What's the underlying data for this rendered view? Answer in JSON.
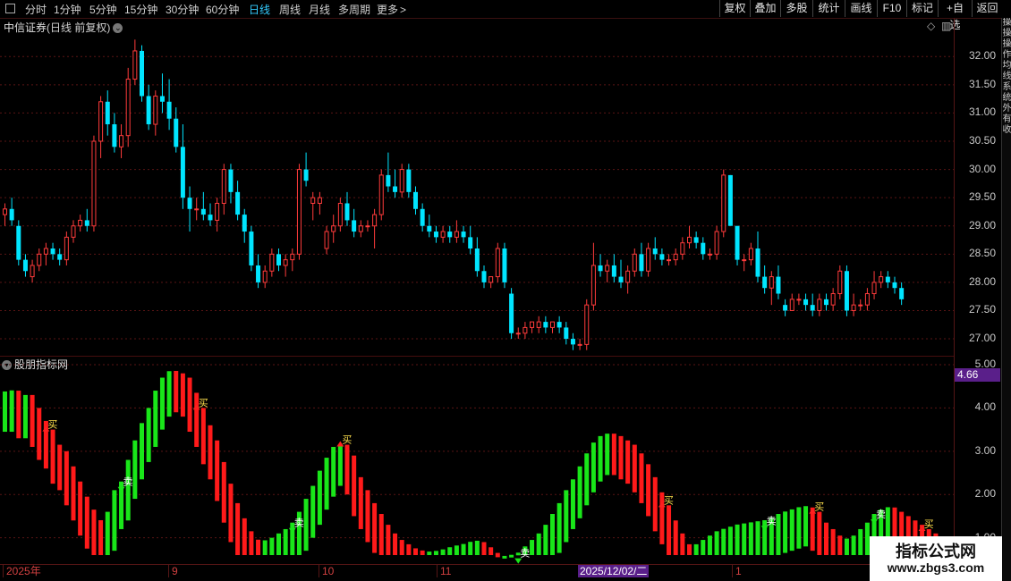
{
  "toolbar": {
    "timeframes": [
      {
        "label": "分时",
        "active": false
      },
      {
        "label": "1分钟",
        "active": false
      },
      {
        "label": "5分钟",
        "active": false
      },
      {
        "label": "15分钟",
        "active": false
      },
      {
        "label": "30分钟",
        "active": false
      },
      {
        "label": "60分钟",
        "active": false
      },
      {
        "label": "日线",
        "active": true
      },
      {
        "label": "周线",
        "active": false
      },
      {
        "label": "月线",
        "active": false
      },
      {
        "label": "多周期",
        "active": false
      },
      {
        "label": "更多",
        "active": false
      }
    ],
    "more_arrow": ">",
    "right_buttons": [
      "复权",
      "叠加",
      "多股",
      "统计",
      "画线",
      "F10",
      "标记",
      "+自选",
      "返回"
    ]
  },
  "chart": {
    "title": "中信证券",
    "subtitle": "(日线 前复权)",
    "y_ticks": [
      "32.00",
      "31.50",
      "31.00",
      "30.50",
      "30.00",
      "29.50",
      "29.00",
      "28.50",
      "28.00",
      "27.50",
      "27.00"
    ]
  },
  "indicator": {
    "title": "股朋指标网",
    "current_value": "4.66",
    "y_ticks": [
      "5.00",
      "4.00",
      "3.00",
      "2.00",
      "1.00"
    ],
    "buy_label": "买",
    "sell_label": "卖",
    "buy_signals": [
      6,
      28,
      49,
      96,
      118,
      134
    ],
    "sell_signals": [
      17,
      42,
      75,
      111,
      127
    ]
  },
  "date_axis": {
    "labels": [
      "2025年",
      "9",
      "10",
      "11",
      "1"
    ],
    "cursor": "2025/12/02/二"
  },
  "side_strip": [
    "操",
    "操",
    "操",
    "作",
    "均",
    "线",
    "系",
    "统",
    "外",
    "有",
    "收"
  ],
  "watermark": {
    "title": "指标公式网",
    "url": "www.zbgs3.com"
  },
  "colors": {
    "up": "#ff3b3b",
    "down": "#00e5ff",
    "ind_red": "#ff1a1a",
    "ind_green": "#19e619",
    "accent_purple": "#5a1f8a"
  },
  "chart_data": {
    "type": "candlestick",
    "price_range": [
      26.7,
      32.4
    ],
    "indicator_range": [
      0.6,
      5.0
    ],
    "candles": [
      [
        29.2,
        29.4,
        29.0,
        29.3
      ],
      [
        29.3,
        29.5,
        29.0,
        29.1
      ],
      [
        29.0,
        29.1,
        28.3,
        28.4
      ],
      [
        28.4,
        28.5,
        28.1,
        28.2
      ],
      [
        28.1,
        28.4,
        28.0,
        28.3
      ],
      [
        28.3,
        28.6,
        28.2,
        28.5
      ],
      [
        28.5,
        28.7,
        28.3,
        28.6
      ],
      [
        28.6,
        28.7,
        28.4,
        28.5
      ],
      [
        28.5,
        28.6,
        28.3,
        28.4
      ],
      [
        28.4,
        28.9,
        28.3,
        28.8
      ],
      [
        28.8,
        29.1,
        28.7,
        29.0
      ],
      [
        29.0,
        29.2,
        28.9,
        29.1
      ],
      [
        29.1,
        29.3,
        28.9,
        29.0
      ],
      [
        29.0,
        30.6,
        28.9,
        30.5
      ],
      [
        30.5,
        31.3,
        30.2,
        31.2
      ],
      [
        31.2,
        31.4,
        30.6,
        30.8
      ],
      [
        30.8,
        31.0,
        30.3,
        30.4
      ],
      [
        30.4,
        30.8,
        30.2,
        30.6
      ],
      [
        30.6,
        31.8,
        30.4,
        31.6
      ],
      [
        31.6,
        32.3,
        31.5,
        32.1
      ],
      [
        32.1,
        32.2,
        31.2,
        31.3
      ],
      [
        31.3,
        31.5,
        30.7,
        30.8
      ],
      [
        30.8,
        31.4,
        30.6,
        31.3
      ],
      [
        31.3,
        31.7,
        31.0,
        31.2
      ],
      [
        31.2,
        31.6,
        30.7,
        30.9
      ],
      [
        30.9,
        31.1,
        30.3,
        30.4
      ],
      [
        30.4,
        30.8,
        29.3,
        29.5
      ],
      [
        29.5,
        29.7,
        28.9,
        29.3
      ],
      [
        29.3,
        29.5,
        29.1,
        29.3
      ],
      [
        29.3,
        29.6,
        29.1,
        29.2
      ],
      [
        29.2,
        29.4,
        29.0,
        29.1
      ],
      [
        29.1,
        29.5,
        28.9,
        29.4
      ],
      [
        29.4,
        30.1,
        29.2,
        30.0
      ],
      [
        30.0,
        30.1,
        29.4,
        29.6
      ],
      [
        29.6,
        29.8,
        29.1,
        29.2
      ],
      [
        29.2,
        29.3,
        28.7,
        28.9
      ],
      [
        28.9,
        29.0,
        28.2,
        28.3
      ],
      [
        28.3,
        28.5,
        27.9,
        28.0
      ],
      [
        28.0,
        28.3,
        27.9,
        28.2
      ],
      [
        28.2,
        28.6,
        28.1,
        28.5
      ],
      [
        28.5,
        28.6,
        28.2,
        28.3
      ],
      [
        28.3,
        28.5,
        28.1,
        28.4
      ],
      [
        28.4,
        28.6,
        28.2,
        28.5
      ],
      [
        28.5,
        30.1,
        28.4,
        30.0
      ],
      [
        30.0,
        30.3,
        29.7,
        29.8
      ],
      [
        29.4,
        29.6,
        29.1,
        29.5
      ],
      [
        29.4,
        29.6,
        29.2,
        29.5
      ],
      [
        28.6,
        29.0,
        28.5,
        28.9
      ],
      [
        28.9,
        29.2,
        28.7,
        29.0
      ],
      [
        29.0,
        29.5,
        28.9,
        29.4
      ],
      [
        29.4,
        29.6,
        29.0,
        29.1
      ],
      [
        29.1,
        29.3,
        28.8,
        28.9
      ],
      [
        28.9,
        29.1,
        28.8,
        29.0
      ],
      [
        29.0,
        29.1,
        28.9,
        29.0
      ],
      [
        29.0,
        29.3,
        28.6,
        29.2
      ],
      [
        29.2,
        30.0,
        29.1,
        29.9
      ],
      [
        29.9,
        30.3,
        29.6,
        29.7
      ],
      [
        29.7,
        30.0,
        29.5,
        29.6
      ],
      [
        29.6,
        30.1,
        29.5,
        30.0
      ],
      [
        30.0,
        30.1,
        29.5,
        29.6
      ],
      [
        29.6,
        29.7,
        29.2,
        29.3
      ],
      [
        29.3,
        29.4,
        28.9,
        29.0
      ],
      [
        29.0,
        29.2,
        28.8,
        28.9
      ],
      [
        28.9,
        29.0,
        28.7,
        28.8
      ],
      [
        28.8,
        29.0,
        28.7,
        28.9
      ],
      [
        28.9,
        29.0,
        28.7,
        28.8
      ],
      [
        28.8,
        29.1,
        28.7,
        28.9
      ],
      [
        28.9,
        29.0,
        28.7,
        28.8
      ],
      [
        28.8,
        29.0,
        28.5,
        28.6
      ],
      [
        28.6,
        28.8,
        28.1,
        28.2
      ],
      [
        28.2,
        28.3,
        27.9,
        28.0
      ],
      [
        28.0,
        28.1,
        27.9,
        28.1
      ],
      [
        28.1,
        28.7,
        28.0,
        28.6
      ],
      [
        28.6,
        28.7,
        27.9,
        28.0
      ],
      [
        27.8,
        27.9,
        27.0,
        27.1
      ],
      [
        27.1,
        27.2,
        27.0,
        27.1
      ],
      [
        27.1,
        27.3,
        27.0,
        27.2
      ],
      [
        27.2,
        27.3,
        27.1,
        27.3
      ],
      [
        27.2,
        27.4,
        27.1,
        27.3
      ],
      [
        27.3,
        27.4,
        27.1,
        27.2
      ],
      [
        27.2,
        27.3,
        27.1,
        27.3
      ],
      [
        27.3,
        27.4,
        27.1,
        27.2
      ],
      [
        27.2,
        27.3,
        26.9,
        27.0
      ],
      [
        27.0,
        27.1,
        26.8,
        26.9
      ],
      [
        26.9,
        27.0,
        26.8,
        26.9
      ],
      [
        26.9,
        27.7,
        26.8,
        27.6
      ],
      [
        27.6,
        28.7,
        27.5,
        28.3
      ],
      [
        28.3,
        28.5,
        28.1,
        28.2
      ],
      [
        28.2,
        28.4,
        28.0,
        28.3
      ],
      [
        28.3,
        28.5,
        28.0,
        28.1
      ],
      [
        28.1,
        28.4,
        27.9,
        28.0
      ],
      [
        28.0,
        28.3,
        27.8,
        28.2
      ],
      [
        28.2,
        28.6,
        28.1,
        28.5
      ],
      [
        28.5,
        28.7,
        28.1,
        28.2
      ],
      [
        28.2,
        28.7,
        28.1,
        28.6
      ],
      [
        28.6,
        28.8,
        28.4,
        28.5
      ],
      [
        28.5,
        28.6,
        28.3,
        28.4
      ],
      [
        28.4,
        28.5,
        28.3,
        28.4
      ],
      [
        28.4,
        28.6,
        28.3,
        28.5
      ],
      [
        28.5,
        28.8,
        28.4,
        28.7
      ],
      [
        28.7,
        29.0,
        28.6,
        28.8
      ],
      [
        28.8,
        28.9,
        28.6,
        28.7
      ],
      [
        28.7,
        28.8,
        28.4,
        28.5
      ],
      [
        28.5,
        28.6,
        28.4,
        28.5
      ],
      [
        28.5,
        29.0,
        28.4,
        28.9
      ],
      [
        28.9,
        30.0,
        28.8,
        29.9
      ],
      [
        29.9,
        29.9,
        29.1,
        29.0
      ],
      [
        29.0,
        29.0,
        28.3,
        28.4
      ],
      [
        28.4,
        28.5,
        28.2,
        28.4
      ],
      [
        28.4,
        28.7,
        28.3,
        28.6
      ],
      [
        28.6,
        28.9,
        28.0,
        28.1
      ],
      [
        28.1,
        28.3,
        27.8,
        27.9
      ],
      [
        27.9,
        28.2,
        27.6,
        28.1
      ],
      [
        28.1,
        28.3,
        27.7,
        27.8
      ],
      [
        27.6,
        27.7,
        27.4,
        27.5
      ],
      [
        27.5,
        27.8,
        27.5,
        27.7
      ],
      [
        27.7,
        27.8,
        27.6,
        27.7
      ],
      [
        27.7,
        27.8,
        27.5,
        27.6
      ],
      [
        27.6,
        27.8,
        27.4,
        27.5
      ],
      [
        27.5,
        27.8,
        27.4,
        27.7
      ],
      [
        27.7,
        27.8,
        27.5,
        27.6
      ],
      [
        27.6,
        27.9,
        27.5,
        27.8
      ],
      [
        27.8,
        28.3,
        27.7,
        28.2
      ],
      [
        28.2,
        28.3,
        27.4,
        27.5
      ],
      [
        27.5,
        27.8,
        27.4,
        27.6
      ],
      [
        27.6,
        27.7,
        27.5,
        27.6
      ],
      [
        27.6,
        27.9,
        27.5,
        27.8
      ],
      [
        27.8,
        28.2,
        27.7,
        28.0
      ],
      [
        28.0,
        28.2,
        27.9,
        28.1
      ],
      [
        28.1,
        28.2,
        27.9,
        28.0
      ],
      [
        28.0,
        28.1,
        27.8,
        27.9
      ],
      [
        27.9,
        28.0,
        27.6,
        27.7
      ]
    ],
    "indicator": [
      4.35,
      4.4,
      4.2,
      4.3,
      4.0,
      3.7,
      3.5,
      3.15,
      3.0,
      2.65,
      2.3,
      1.95,
      1.65,
      1.4,
      1.35,
      1.6,
      2.1,
      2.3,
      2.8,
      3.25,
      3.65,
      4.0,
      4.4,
      4.7,
      4.85,
      4.8,
      4.7,
      4.35,
      4.0,
      3.6,
      3.25,
      2.75,
      2.25,
      1.8,
      1.45,
      1.15,
      0.95,
      0.9,
      0.92,
      1.0,
      1.1,
      1.2,
      1.35,
      1.6,
      1.9,
      2.2,
      2.55,
      2.85,
      3.1,
      3.15,
      2.9,
      2.4,
      2.1,
      1.8,
      1.55,
      1.3,
      1.1,
      0.95,
      0.85,
      0.75,
      0.7,
      0.65,
      0.65,
      0.68,
      0.72,
      0.78,
      0.8,
      0.85,
      0.9,
      0.9,
      0.78,
      0.65,
      0.55,
      0.55,
      0.6,
      0.65,
      0.8,
      0.95,
      1.1,
      1.3,
      1.55,
      1.8,
      2.1,
      2.35,
      2.65,
      2.95,
      3.2,
      3.35,
      3.4,
      3.35,
      3.25,
      3.15,
      2.95,
      2.7,
      2.4,
      2.05,
      1.75,
      1.4,
      1.1,
      0.85,
      0.78,
      0.85,
      0.95,
      1.05,
      1.15,
      1.2,
      1.25,
      1.3,
      1.3,
      1.35,
      1.35,
      1.4,
      1.45,
      1.55,
      1.6,
      1.65,
      1.7,
      1.7,
      1.6,
      1.35,
      1.2,
      1.05,
      0.95,
      0.95,
      1.05,
      1.2,
      1.35,
      1.55,
      1.65,
      1.7,
      1.6,
      1.5,
      1.4,
      1.3,
      1.2,
      1.1,
      1.0,
      0.9,
      0.8
    ]
  }
}
